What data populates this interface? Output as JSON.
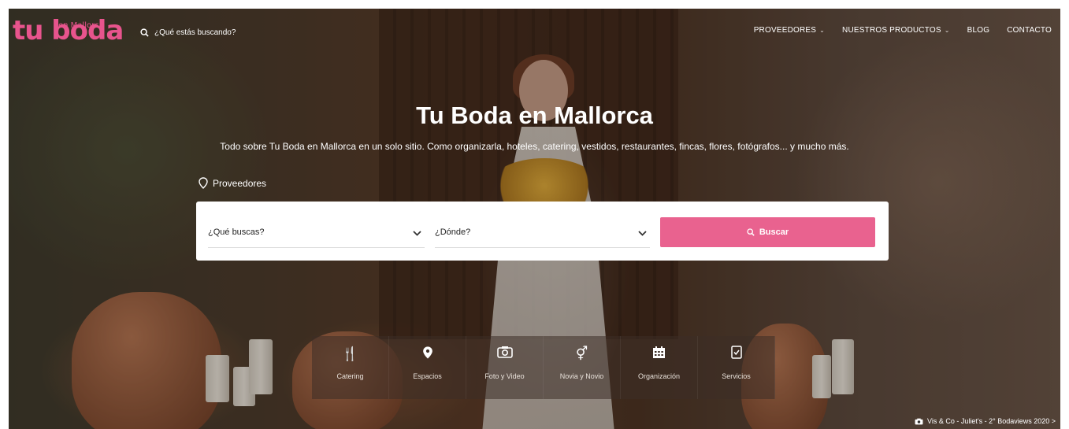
{
  "brand": {
    "logo_main": "tu boda",
    "logo_sub": "en Mallorca",
    "accent": "#e9628f"
  },
  "header": {
    "search_placeholder": "¿Qué estás buscando?",
    "nav": [
      {
        "label": "PROVEEDORES",
        "has_dropdown": true
      },
      {
        "label": "NUESTROS PRODUCTOS",
        "has_dropdown": true
      },
      {
        "label": "BLOG",
        "has_dropdown": false
      },
      {
        "label": "CONTACTO",
        "has_dropdown": false
      }
    ]
  },
  "hero": {
    "title": "Tu Boda en Mallorca",
    "subtitle": "Todo sobre Tu Boda en Mallorca en un solo sitio. Como organizarla, hoteles, catering, vestidos, restaurantes, fincas, flores, fotógrafos... y mucho más.",
    "providers_link": "Proveedores"
  },
  "search": {
    "what_label": "¿Qué buscas?",
    "where_label": "¿Dónde?",
    "button_label": "Buscar"
  },
  "categories": [
    {
      "label": "Catering",
      "icon": "cutlery-icon"
    },
    {
      "label": "Espacios",
      "icon": "location-pin-icon"
    },
    {
      "label": "Foto y Video",
      "icon": "camera-icon"
    },
    {
      "label": "Novia y Novio",
      "icon": "couple-icon"
    },
    {
      "label": "Organización",
      "icon": "calendar-icon"
    },
    {
      "label": "Servicios",
      "icon": "checklist-icon"
    }
  ],
  "credit": {
    "text": "Vis & Co - Juliet's - 2° Bodaviews 2020 >"
  }
}
